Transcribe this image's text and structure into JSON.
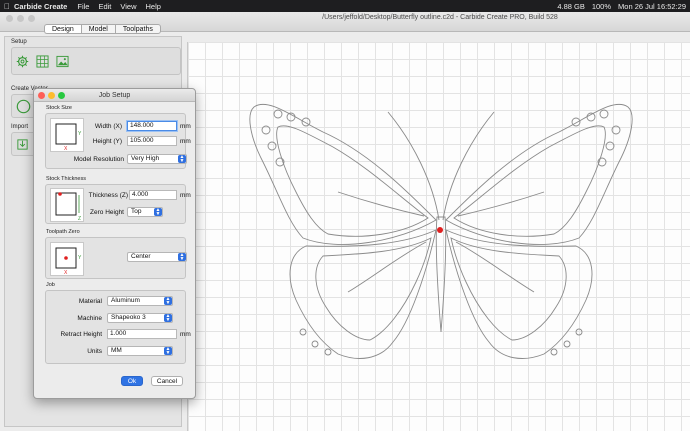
{
  "menubar": {
    "app_name": "Carbide Create",
    "items": [
      "File",
      "Edit",
      "View",
      "Help"
    ],
    "status": {
      "storage": "4.88 GB",
      "battery": "100%",
      "datetime": "Mon 26 Jul  16:52:29"
    }
  },
  "window": {
    "title": "/Users/jeffold/Desktop/Butterfly outline.c2d - Carbide Create PRO, Build 528",
    "tabs": [
      "Design",
      "Model",
      "Toolpaths"
    ],
    "active_tab": "Design"
  },
  "left_panel": {
    "sections": {
      "setup": "Setup",
      "create_vector": "Create Vector",
      "import": "Import"
    }
  },
  "dialog": {
    "title": "Job Setup",
    "stock_size": {
      "label": "Stock Size",
      "width_label": "Width (X)",
      "width_value": "148.000",
      "height_label": "Height (Y)",
      "height_value": "105.000",
      "unit": "mm",
      "resolution_label": "Model Resolution",
      "resolution_value": "Very High"
    },
    "stock_thickness": {
      "label": "Stock Thickness",
      "thickness_label": "Thickness (Z)",
      "thickness_value": "4.000",
      "unit": "mm",
      "zero_height_label": "Zero Height",
      "zero_height_value": "Top"
    },
    "toolpath_zero": {
      "label": "Toolpath Zero",
      "value": "Center"
    },
    "job": {
      "label": "Job",
      "material_label": "Material",
      "material_value": "Aluminum",
      "machine_label": "Machine",
      "machine_value": "Shapeoko 3",
      "retract_label": "Retract Height",
      "retract_value": "1.000",
      "retract_unit": "mm",
      "units_label": "Units",
      "units_value": "MM"
    },
    "ok_label": "Ok",
    "cancel_label": "Cancel"
  },
  "colors": {
    "accent": "#2f73e4",
    "icon_green": "#3a9a3a",
    "origin_red": "#e02020"
  }
}
